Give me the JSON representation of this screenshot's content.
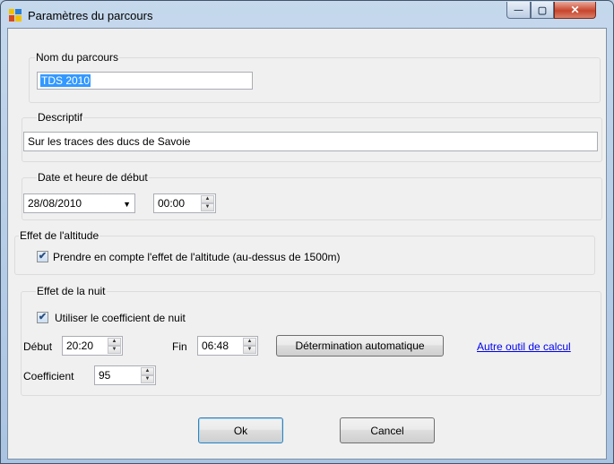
{
  "window": {
    "title": "Paramètres du parcours",
    "minimize_glyph": "—",
    "maximize_glyph": "▢",
    "close_glyph": "✕"
  },
  "route_name": {
    "group_label": "Nom du parcours",
    "value": "TDS 2010"
  },
  "description": {
    "group_label": "Descriptif",
    "value": "Sur les traces des ducs de Savoie"
  },
  "start": {
    "group_label": "Date et heure de début",
    "date_value": "28/08/2010",
    "time_value": "00:00"
  },
  "altitude": {
    "group_label": "Effet de l'altitude",
    "checkbox_label": "Prendre en compte l'effet de l'altitude (au-dessus de 1500m)",
    "checked": true
  },
  "night": {
    "group_label": "Effet de la nuit",
    "checkbox_label": "Utiliser le coefficient de nuit",
    "checked": true,
    "start_label": "Début",
    "start_value": "20:20",
    "end_label": "Fin",
    "end_value": "06:48",
    "auto_button": "Détermination automatique",
    "other_tool_link": "Autre outil de calcul",
    "coefficient_label": "Coefficient",
    "coefficient_value": "95"
  },
  "footer": {
    "ok_label": "Ok",
    "cancel_label": "Cancel"
  },
  "icons": {
    "check": "✔",
    "spin_up": "▲",
    "spin_down": "▼",
    "dropdown": "▼"
  }
}
